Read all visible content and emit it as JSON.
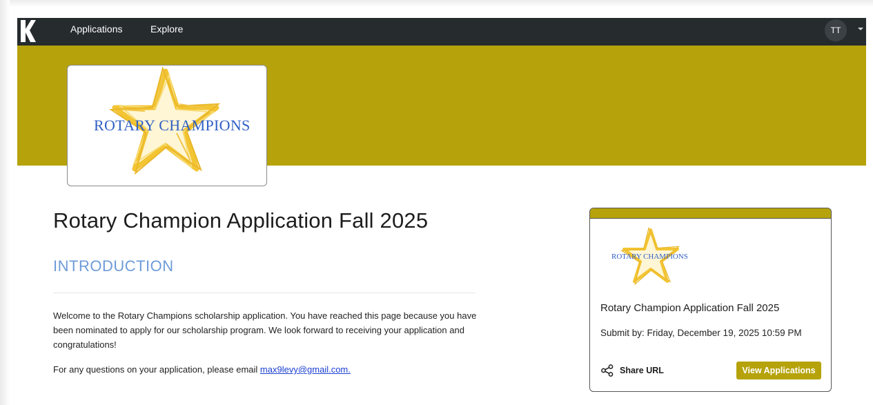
{
  "nav": {
    "logo_letter": "K",
    "links": [
      "Applications",
      "Explore"
    ],
    "avatar_initials": "TT"
  },
  "brand": {
    "logo_text": "ROTARY CHAMPIONS"
  },
  "page": {
    "title": "Rotary Champion Application Fall 2025",
    "section_heading": "INTRODUCTION",
    "intro_text": "Welcome to the Rotary Champions scholarship application. You have reached this page because you have been nominated to apply for our scholarship program. We look forward to receiving your application and congratulations!",
    "contact_prefix": "For any questions on your application, please email",
    "contact_email": "max9levy@gmail.com."
  },
  "sidebar": {
    "title": "Rotary Champion Application Fall 2025",
    "submit_by": "Submit by:  Friday, December 19, 2025 10:59 PM",
    "share_label": "Share URL",
    "view_button_label": "View Applications"
  },
  "colors": {
    "nav_bg": "#262b2e",
    "accent_gold": "#b6a30c",
    "heading_blue": "#6d9bd9",
    "link_blue": "#1a3fd1",
    "logo_text_blue": "#2f5fc4",
    "star_gold": "#f3c533"
  },
  "icons": [
    "k-logo-icon",
    "chevron-down-icon",
    "star-logo-icon",
    "share-icon"
  ]
}
